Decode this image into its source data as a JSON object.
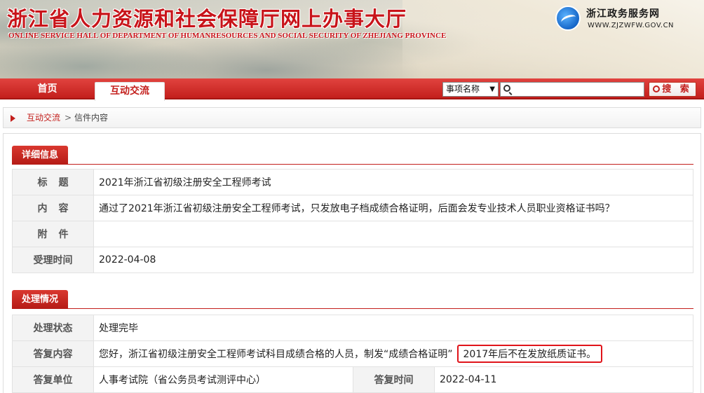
{
  "header": {
    "title": "浙江省人力资源和社会保障厅网上办事大厅",
    "subtitle": "ONLINE SERVICE HALL OF DEPARTMENT OF HUMANRESOURCES AND SOCIAL SECURITY OF ZHEJIANG PROVINCE",
    "portal_name": "浙江政务服务网",
    "portal_url": "WWW.ZJZWFW.GOV.CN"
  },
  "nav": {
    "home": "首页",
    "interact": "互动交流",
    "search_select": "事项名称",
    "search_button": "搜 索"
  },
  "breadcrumb": {
    "crumb1": "互动交流",
    "sep": ">",
    "crumb2": "信件内容"
  },
  "detail": {
    "heading": "详细信息",
    "rows": [
      {
        "key": "标题",
        "value": "2021年浙江省初级注册安全工程师考试"
      },
      {
        "key": "内容",
        "value": "通过了2021年浙江省初级注册安全工程师考试，只发放电子档成绩合格证明，后面会发专业技术人员职业资格证书吗？"
      },
      {
        "key": "附件",
        "value": ""
      },
      {
        "key": "受理时间",
        "value": "2022-04-08"
      }
    ]
  },
  "process": {
    "heading": "处理情况",
    "status_key": "处理状态",
    "status_value": "处理完毕",
    "reply_key": "答复内容",
    "reply_value": "您好，浙江省初级注册安全工程师考试科目成绩合格的人员，制发“成绩合格证明”",
    "reply_highlight": "2017年后不在发放纸质证书。",
    "unit_key": "答复单位",
    "unit_value": "人事考试院（省公务员考试测评中心）",
    "time_key": "答复时间",
    "time_value": "2022-04-11"
  },
  "colors": {
    "accent": "#c31f1c",
    "highlight_border": "#e0141a"
  }
}
